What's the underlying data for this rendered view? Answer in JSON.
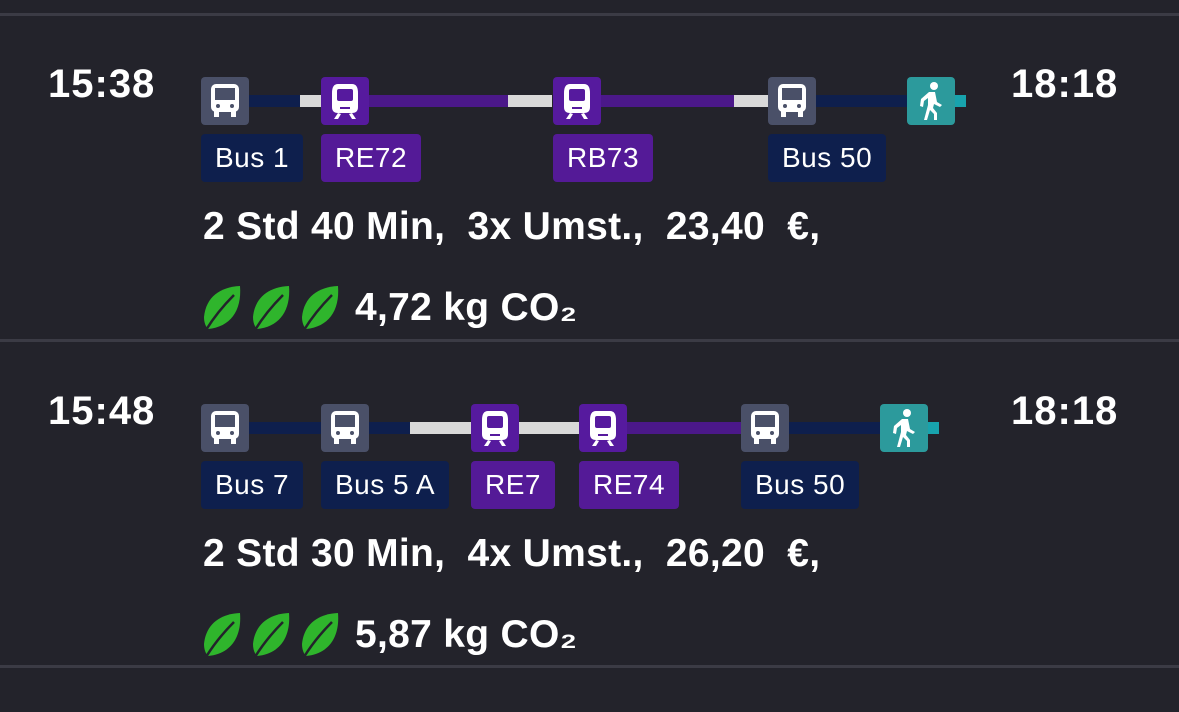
{
  "colors": {
    "background": "#23232b",
    "bus_line": "#0e1f4d",
    "rail_line": "#4b1889",
    "transfer_line": "#d9d9d9",
    "walk_line": "#18a3ad",
    "leaf": "#2fb52c"
  },
  "connections": [
    {
      "departure": "15:38",
      "arrival": "18:18",
      "icons": [
        "bus-icon",
        "train-icon",
        "train-icon",
        "bus-icon",
        "walking-icon"
      ],
      "legs": [
        "Bus 1",
        "RE72",
        "RB73",
        "Bus 50"
      ],
      "summary": "2 Std 40 Min,  3x Umst.,  23,40  €,",
      "co2": "4,72 kg CO₂",
      "eco_leaves": 3
    },
    {
      "departure": "15:48",
      "arrival": "18:18",
      "icons": [
        "bus-icon",
        "bus-icon",
        "train-icon",
        "train-icon",
        "bus-icon",
        "walking-icon"
      ],
      "legs": [
        "Bus 7",
        "Bus 5 A",
        "RE7",
        "RE74",
        "Bus 50"
      ],
      "summary": "2 Std 30 Min,  4x Umst.,  26,20  €,",
      "co2": "5,87 kg CO₂",
      "eco_leaves": 3
    }
  ]
}
